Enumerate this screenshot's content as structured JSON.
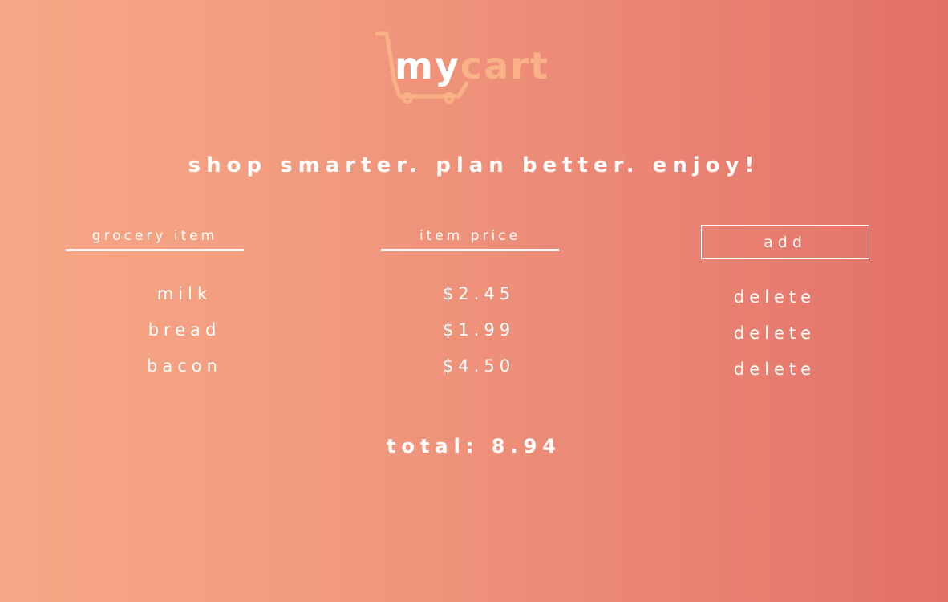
{
  "logo": {
    "part1": "my",
    "part2": "cart",
    "icon": "shopping-cart-icon"
  },
  "tagline": "shop smarter. plan better. enjoy!",
  "form": {
    "name_placeholder": "grocery item",
    "price_placeholder": "item price",
    "add_label": "add"
  },
  "items": [
    {
      "name": "milk",
      "price": "$2.45",
      "delete_label": "delete"
    },
    {
      "name": "bread",
      "price": "$1.99",
      "delete_label": "delete"
    },
    {
      "name": "bacon",
      "price": "$4.50",
      "delete_label": "delete"
    }
  ],
  "total": "total: 8.94",
  "colors": {
    "gradient_start": "#f8a886",
    "gradient_end": "#e37068",
    "logo_accent": "#f9b286",
    "text": "#ffffff"
  }
}
